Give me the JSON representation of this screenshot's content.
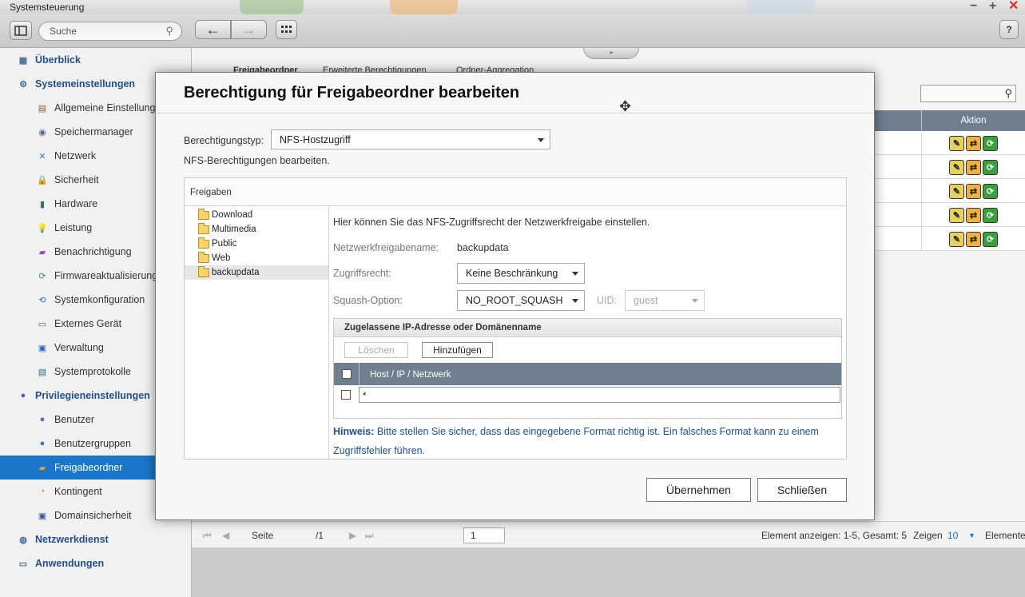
{
  "window": {
    "title": "Systemsteuerung"
  },
  "toolbar": {
    "search_placeholder": "Suche",
    "help_label": "?"
  },
  "sidebar": {
    "items": [
      {
        "label": "Überblick",
        "level": "top",
        "icon": "overview-icon"
      },
      {
        "label": "Systemeinstellungen",
        "level": "top",
        "icon": "gear-icon"
      },
      {
        "label": "Allgemeine Einstellungen",
        "level": "sub",
        "icon": "general-settings-icon"
      },
      {
        "label": "Speichermanager",
        "level": "sub",
        "icon": "storage-icon"
      },
      {
        "label": "Netzwerk",
        "level": "sub",
        "icon": "network-icon"
      },
      {
        "label": "Sicherheit",
        "level": "sub",
        "icon": "lock-icon"
      },
      {
        "label": "Hardware",
        "level": "sub",
        "icon": "hardware-icon"
      },
      {
        "label": "Leistung",
        "level": "sub",
        "icon": "lightbulb-icon"
      },
      {
        "label": "Benachrichtigung",
        "level": "sub",
        "icon": "notification-icon"
      },
      {
        "label": "Firmwareaktualisierung",
        "level": "sub",
        "icon": "firmware-icon"
      },
      {
        "label": "Systemkonfiguration",
        "level": "sub",
        "icon": "system-config-icon"
      },
      {
        "label": "Externes Gerät",
        "level": "sub",
        "icon": "external-device-icon"
      },
      {
        "label": "Verwaltung",
        "level": "sub",
        "icon": "monitor-icon"
      },
      {
        "label": "Systemprotokolle",
        "level": "sub",
        "icon": "log-icon"
      },
      {
        "label": "Privilegieneinstellungen",
        "level": "top",
        "icon": "privilege-icon"
      },
      {
        "label": "Benutzer",
        "level": "sub",
        "icon": "user-icon"
      },
      {
        "label": "Benutzergruppen",
        "level": "sub",
        "icon": "user-group-icon"
      },
      {
        "label": "Freigabeordner",
        "level": "sub",
        "icon": "shared-folder-icon",
        "active": true
      },
      {
        "label": "Kontingent",
        "level": "sub",
        "icon": "quota-icon"
      },
      {
        "label": "Domainsicherheit",
        "level": "sub",
        "icon": "domain-security-icon"
      },
      {
        "label": "Netzwerkdienst",
        "level": "top",
        "icon": "network-service-icon"
      },
      {
        "label": "Anwendungen",
        "level": "top",
        "icon": "applications-icon"
      }
    ]
  },
  "background": {
    "tabs": [
      "Freigabeordner",
      "Erweiterte Berechtigungen",
      "Ordner-Aggregation"
    ],
    "table_header_action": "Aktion",
    "row_count": 5,
    "footer": {
      "page_label": "Seite",
      "page_value": "1",
      "page_total": "/1",
      "display_info": "Element anzeigen: 1-5, Gesamt: 5",
      "show_label": "Zeigen",
      "show_value": "10",
      "items_label": "Elemente"
    }
  },
  "dialog": {
    "title": "Berechtigung für Freigabeordner bearbeiten",
    "permission_type_label": "Berechtigungstyp:",
    "permission_type_value": "NFS-Hostzugriff",
    "subtitle": "NFS-Berechtigungen bearbeiten.",
    "shares_header": "Freigaben",
    "folders": [
      "Download",
      "Multimedia",
      "Public",
      "Web",
      "backupdata"
    ],
    "selected_folder": "backupdata",
    "description": "Hier können Sie das NFS-Zugriffsrecht der Netzwerkfreigabe einstellen.",
    "share_name_label": "Netzwerkfreigabename:",
    "share_name_value": "backupdata",
    "access_label": "Zugriffsrecht:",
    "access_value": "Keine Beschränkung",
    "squash_label": "Squash-Option:",
    "squash_value": "NO_ROOT_SQUASH",
    "uid_label": "UID:",
    "uid_value": "guest",
    "ip_section_title": "Zugelassene IP-Adresse oder Domänenname",
    "delete_label": "Löschen",
    "add_label": "Hinzufügen",
    "grid_column": "Host / IP / Netzwerk",
    "grid_rows": [
      "*"
    ],
    "hint_prefix": "Hinweis:",
    "hint_text": " Bitte stellen Sie sicher, dass das eingegebene Format richtig ist. Ein falsches Format kann zu einem Zugriffsfehler führen.",
    "apply_label": "Übernehmen",
    "close_label": "Schließen"
  },
  "colors": {
    "accent": "#1976c8",
    "header_gray": "#6f7f90",
    "link_blue": "#1f4f8f",
    "close_red": "#d0342c"
  }
}
